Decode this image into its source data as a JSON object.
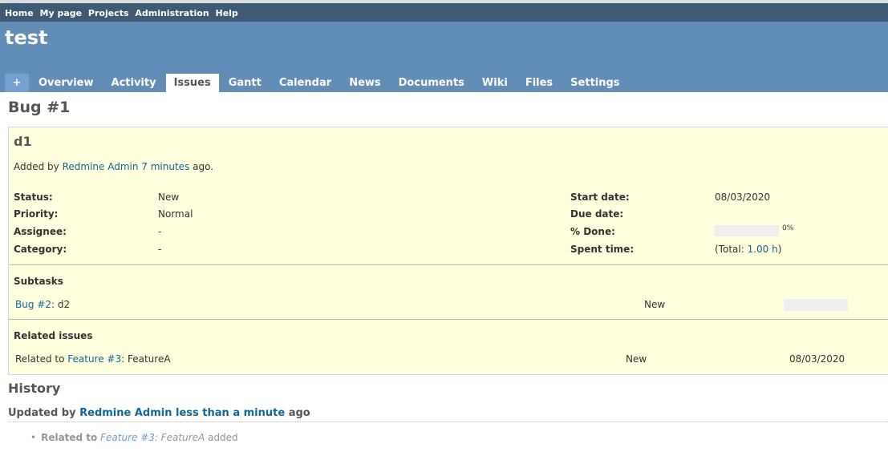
{
  "top_menu": {
    "items": [
      "Home",
      "My page",
      "Projects",
      "Administration",
      "Help"
    ]
  },
  "project": {
    "title": "test"
  },
  "main_menu": {
    "plus_label": "+",
    "tabs": [
      "Overview",
      "Activity",
      "Issues",
      "Gantt",
      "Calendar",
      "News",
      "Documents",
      "Wiki",
      "Files",
      "Settings"
    ],
    "selected": "Issues"
  },
  "issue": {
    "heading": "Bug #1",
    "subject": "d1",
    "added_by_prefix": "Added by",
    "author": "Redmine Admin",
    "age": "7 minutes",
    "age_suffix": "ago.",
    "attributes_left": [
      {
        "label": "Status:",
        "value": "New"
      },
      {
        "label": "Priority:",
        "value": "Normal"
      },
      {
        "label": "Assignee:",
        "value": "-"
      },
      {
        "label": "Category:",
        "value": "-"
      }
    ],
    "start_date_label": "Start date:",
    "start_date": "08/03/2020",
    "due_date_label": "Due date:",
    "due_date": "",
    "done_label": "% Done:",
    "done_percent": 0,
    "done_text": "0%",
    "spent_label": "Spent time:",
    "spent_prefix": "(Total:",
    "spent_value": "1.00 h",
    "spent_suffix": ")"
  },
  "subtasks": {
    "title": "Subtasks",
    "items": [
      {
        "link": "Bug #2",
        "subject": ": d2",
        "status": "New",
        "progress": 0
      }
    ]
  },
  "related": {
    "title": "Related issues",
    "items": [
      {
        "relation": "Related to",
        "link": "Feature #3",
        "subject": ": FeatureA",
        "status": "New",
        "date": "08/03/2020"
      }
    ]
  },
  "history": {
    "title": "History",
    "updated_prefix": "Updated by",
    "author": "Redmine Admin",
    "age": "less than a minute",
    "age_suffix": "ago",
    "detail": {
      "label": "Related to",
      "link": "Feature #3:",
      "subject": "FeatureA",
      "action": "added"
    }
  }
}
